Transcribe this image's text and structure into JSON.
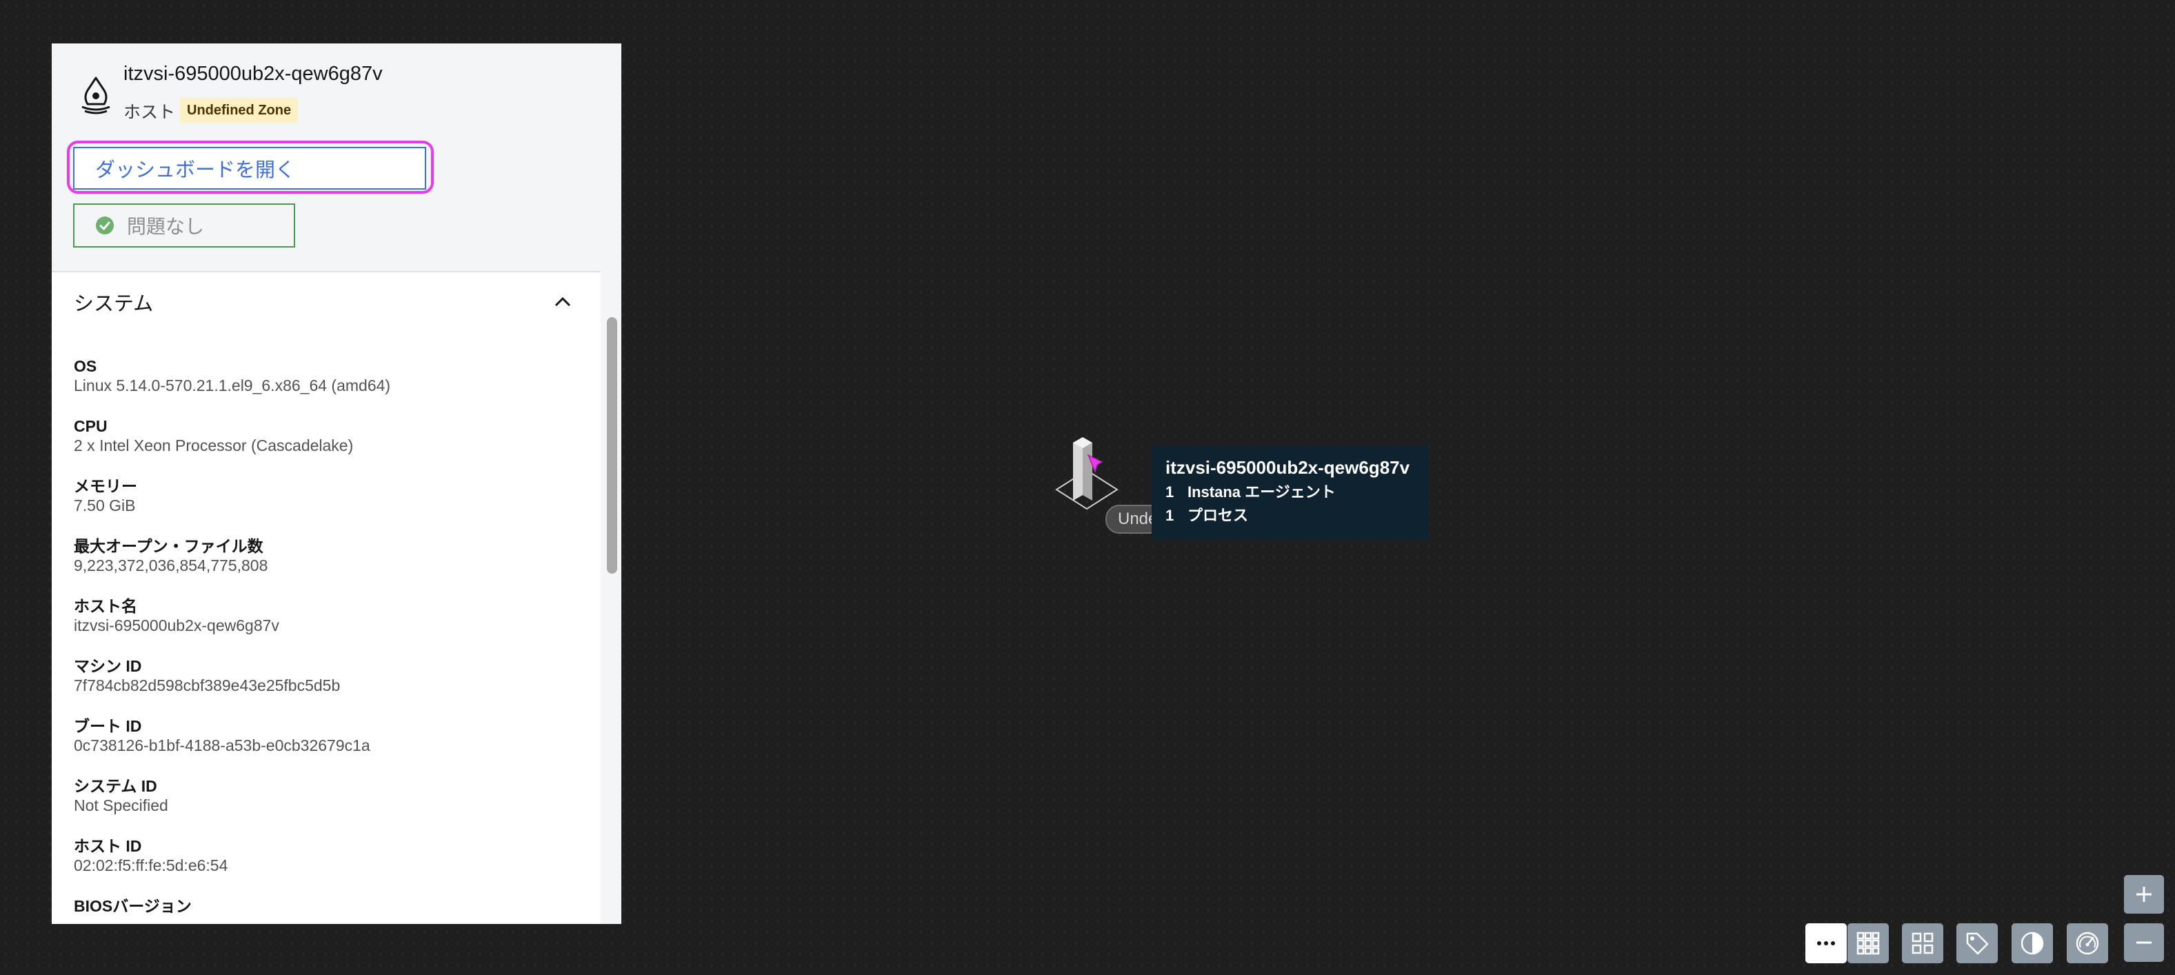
{
  "panel": {
    "host_name": "itzvsi-695000ub2x-qew6g87v",
    "host_type": "ホスト",
    "zone_badge": "Undefined Zone",
    "dashboard_button": "ダッシュボードを開く",
    "status": "問題なし",
    "section_title": "システム",
    "properties": [
      {
        "label": "OS",
        "value": "Linux 5.14.0-570.21.1.el9_6.x86_64 (amd64)"
      },
      {
        "label": "CPU",
        "value": "2 x Intel Xeon Processor (Cascadelake)"
      },
      {
        "label": "メモリー",
        "value": "7.50 GiB"
      },
      {
        "label": "最大オープン・ファイル数",
        "value": "9,223,372,036,854,775,808"
      },
      {
        "label": "ホスト名",
        "value": "itzvsi-695000ub2x-qew6g87v"
      },
      {
        "label": "マシン ID",
        "value": "7f784cb82d598cbf389e43e25fbc5d5b"
      },
      {
        "label": "ブート ID",
        "value": "0c738126-b1bf-4188-a53b-e0cb32679c1a"
      },
      {
        "label": "システム ID",
        "value": "Not Specified"
      },
      {
        "label": "ホスト ID",
        "value": "02:02:f5:ff:fe:5d:e6:54"
      },
      {
        "label": "BIOSバージョン",
        "value": ""
      }
    ]
  },
  "node": {
    "label": "Undefined Zone"
  },
  "tooltip": {
    "title": "itzvsi-695000ub2x-qew6g87v",
    "rows": [
      {
        "count": "1",
        "label": "Instana エージェント"
      },
      {
        "count": "1",
        "label": "プロセス"
      }
    ]
  },
  "toolbar": {
    "tools": [
      "more-options-icon",
      "grid-small-icon",
      "grid-large-icon",
      "tag-icon",
      "pie-icon",
      "gauge-icon"
    ],
    "zoom": [
      "zoom-in-icon",
      "zoom-out-icon"
    ]
  },
  "colors": {
    "accent": "#3f6fd8",
    "focus": "#e83ae8",
    "ok": "#4b9b4b",
    "tooltip_bg": "#0f2230",
    "canvas_bg": "#1f1f1f",
    "toolbar_btn": "#8e9ba6"
  }
}
